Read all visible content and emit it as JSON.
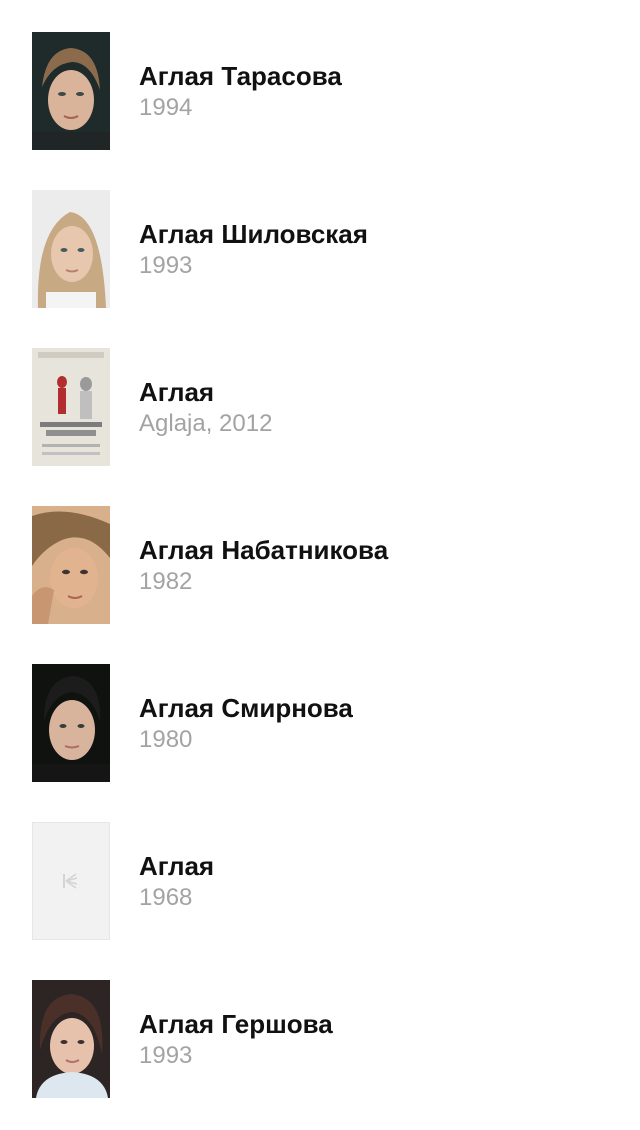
{
  "results": [
    {
      "title": "Аглая Тарасова",
      "subtitle": "1994",
      "image": "photo-portrait"
    },
    {
      "title": "Аглая Шиловская",
      "subtitle": "1993",
      "image": "photo-portrait"
    },
    {
      "title": "Аглая",
      "subtitle": "Aglaja, 2012",
      "image": "movie-poster"
    },
    {
      "title": "Аглая Набатникова",
      "subtitle": "1982",
      "image": "photo-portrait"
    },
    {
      "title": "Аглая Смирнова",
      "subtitle": "1980",
      "image": "photo-portrait"
    },
    {
      "title": "Аглая",
      "subtitle": "1968",
      "image": "placeholder-logo-icon"
    },
    {
      "title": "Аглая Гершова",
      "subtitle": "1993",
      "image": "photo-portrait"
    }
  ],
  "colors": {
    "title": "#111111",
    "subtitle": "#a3a3a3",
    "placeholder_bg": "#f2f2f2"
  }
}
